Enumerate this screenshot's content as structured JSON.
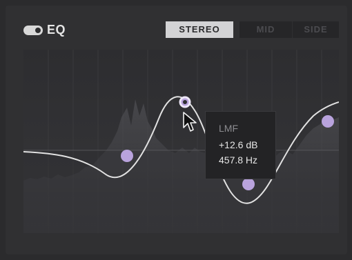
{
  "header": {
    "eq_label": "EQ",
    "eq_enabled": true,
    "modes": [
      {
        "label": "STEREO",
        "active": true
      },
      {
        "label": "MID",
        "active": false
      },
      {
        "label": "SIDE",
        "active": false
      }
    ]
  },
  "tooltip": {
    "band": "LMF",
    "gain": "+12.6 dB",
    "frequency": "457.8 Hz"
  },
  "colors": {
    "background": "#2b2b2d",
    "panel": "#303032",
    "curve": "#e2e2e2",
    "node": "#b9a3dd",
    "active_button": "#d3d3d5"
  },
  "icons": {
    "toggle": "toggle-switch-icon",
    "cursor": "mouse-pointer-icon"
  }
}
